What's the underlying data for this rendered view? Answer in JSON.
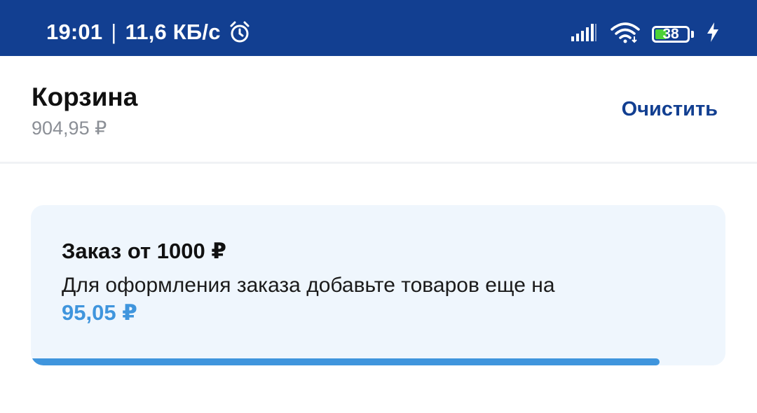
{
  "status_bar": {
    "time": "19:01",
    "separator": "|",
    "network_speed": "11,6 КБ/с",
    "battery_level": "38",
    "icons": {
      "alarm": "alarm-clock-icon",
      "signal": "cell-signal-icon",
      "wifi": "wifi-icon",
      "battery": "battery-icon",
      "charging": "charging-bolt-icon"
    },
    "colors": {
      "background": "#123f91",
      "battery_fill": "#4cd137"
    }
  },
  "header": {
    "title": "Корзина",
    "total": "904,95 ₽",
    "clear_label": "Очистить"
  },
  "notice": {
    "title": "Заказ от 1000 ₽",
    "text": "Для оформления заказа добавьте товаров еще на",
    "amount": "95,05 ₽",
    "progress_fraction": 0.905
  },
  "colors": {
    "accent_blue": "#3f95dd",
    "brand_dark_blue": "#123f91",
    "card_background": "#eff6fd"
  }
}
